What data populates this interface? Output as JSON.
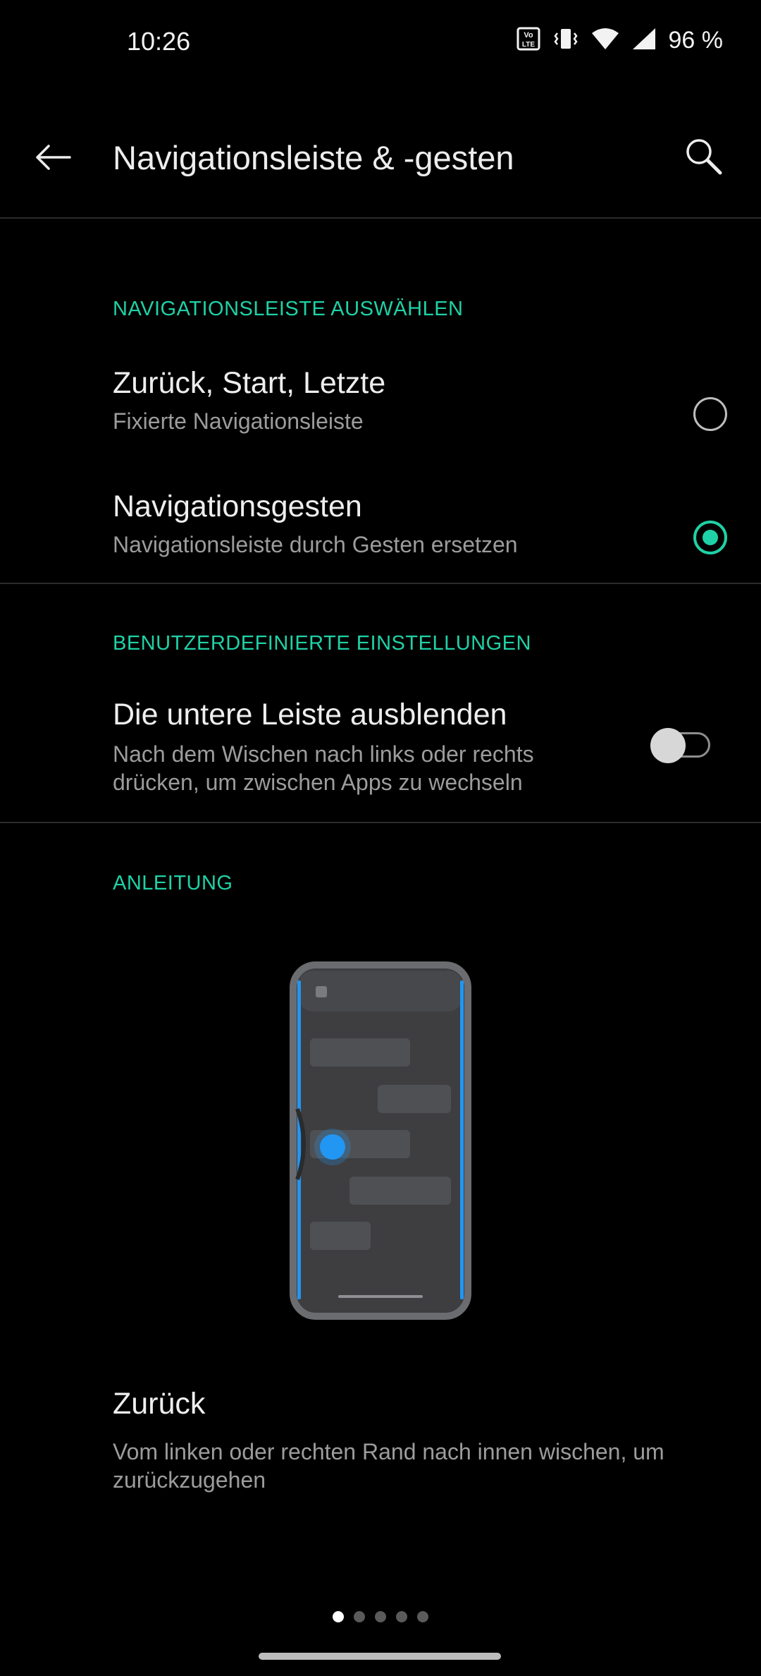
{
  "status_bar": {
    "time": "10:26",
    "battery": "96 %",
    "icons": [
      "volte-icon",
      "vibrate-icon",
      "wifi-icon",
      "signal-icon"
    ]
  },
  "header": {
    "title": "Navigationsleiste & -gesten",
    "back_icon": "arrow-left-icon",
    "search_icon": "search-icon"
  },
  "nav_section": {
    "label": "NAVIGATIONSLEISTE AUSWÄHLEN",
    "options": [
      {
        "title": "Zurück, Start, Letzte",
        "subtitle": "Fixierte Navigationsleiste",
        "selected": false
      },
      {
        "title": "Navigationsgesten",
        "subtitle": "Navigationsleiste durch Gesten ersetzen",
        "selected": true
      }
    ]
  },
  "custom_section": {
    "label": "BENUTZERDEFINIERTE EINSTELLUNGEN",
    "hide_bar": {
      "title": "Die untere Leiste ausblenden",
      "subtitle_line1": "Nach dem Wischen nach links oder rechts",
      "subtitle_line2": "drücken, um zwischen Apps zu wechseln",
      "enabled": false
    }
  },
  "guide_section": {
    "label": "ANLEITUNG",
    "gesture_title": "Zurück",
    "gesture_desc_line1": "Vom linken oder rechten Rand nach innen wischen, um",
    "gesture_desc_line2": "zurückzugehen",
    "page_count": 5,
    "current_page": 1
  },
  "colors": {
    "accent": "#1FD1A6",
    "background": "#000000",
    "illustration_accent": "#2196F3"
  }
}
